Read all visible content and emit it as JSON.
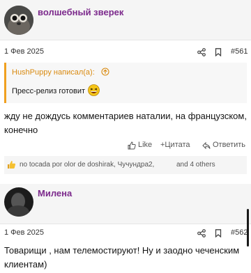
{
  "post1": {
    "username": "волшебный зверек",
    "date": "1 Фев 2025",
    "number": "#561",
    "quote": {
      "author": "HushPuppy написал(а):",
      "text": "Пресс-релиз готовит"
    },
    "body": "жду не дождусь комментариев наталии, на французском, конечно",
    "actions": {
      "like": "Like",
      "quote": "+Цитата",
      "reply": "Ответить"
    },
    "reactions": {
      "names": "no tocada por olor de doshirak, Чучундра2,",
      "others": "and 4 others"
    }
  },
  "post2": {
    "username": "Милена",
    "date": "1 Фев 2025",
    "number": "#562",
    "body": "Товарищи , нам телемостируют! Ну и заодно чеченским клиентам)"
  },
  "colors": {
    "username": "#7c2a8c",
    "quote_accent": "#f0a020",
    "reaction_thumb": "#f0b030"
  },
  "icons": [
    "share-icon",
    "bookmark-icon",
    "quote-arrow-icon",
    "thumbs-up-icon",
    "reply-icon",
    "laughing-emoji-icon"
  ]
}
